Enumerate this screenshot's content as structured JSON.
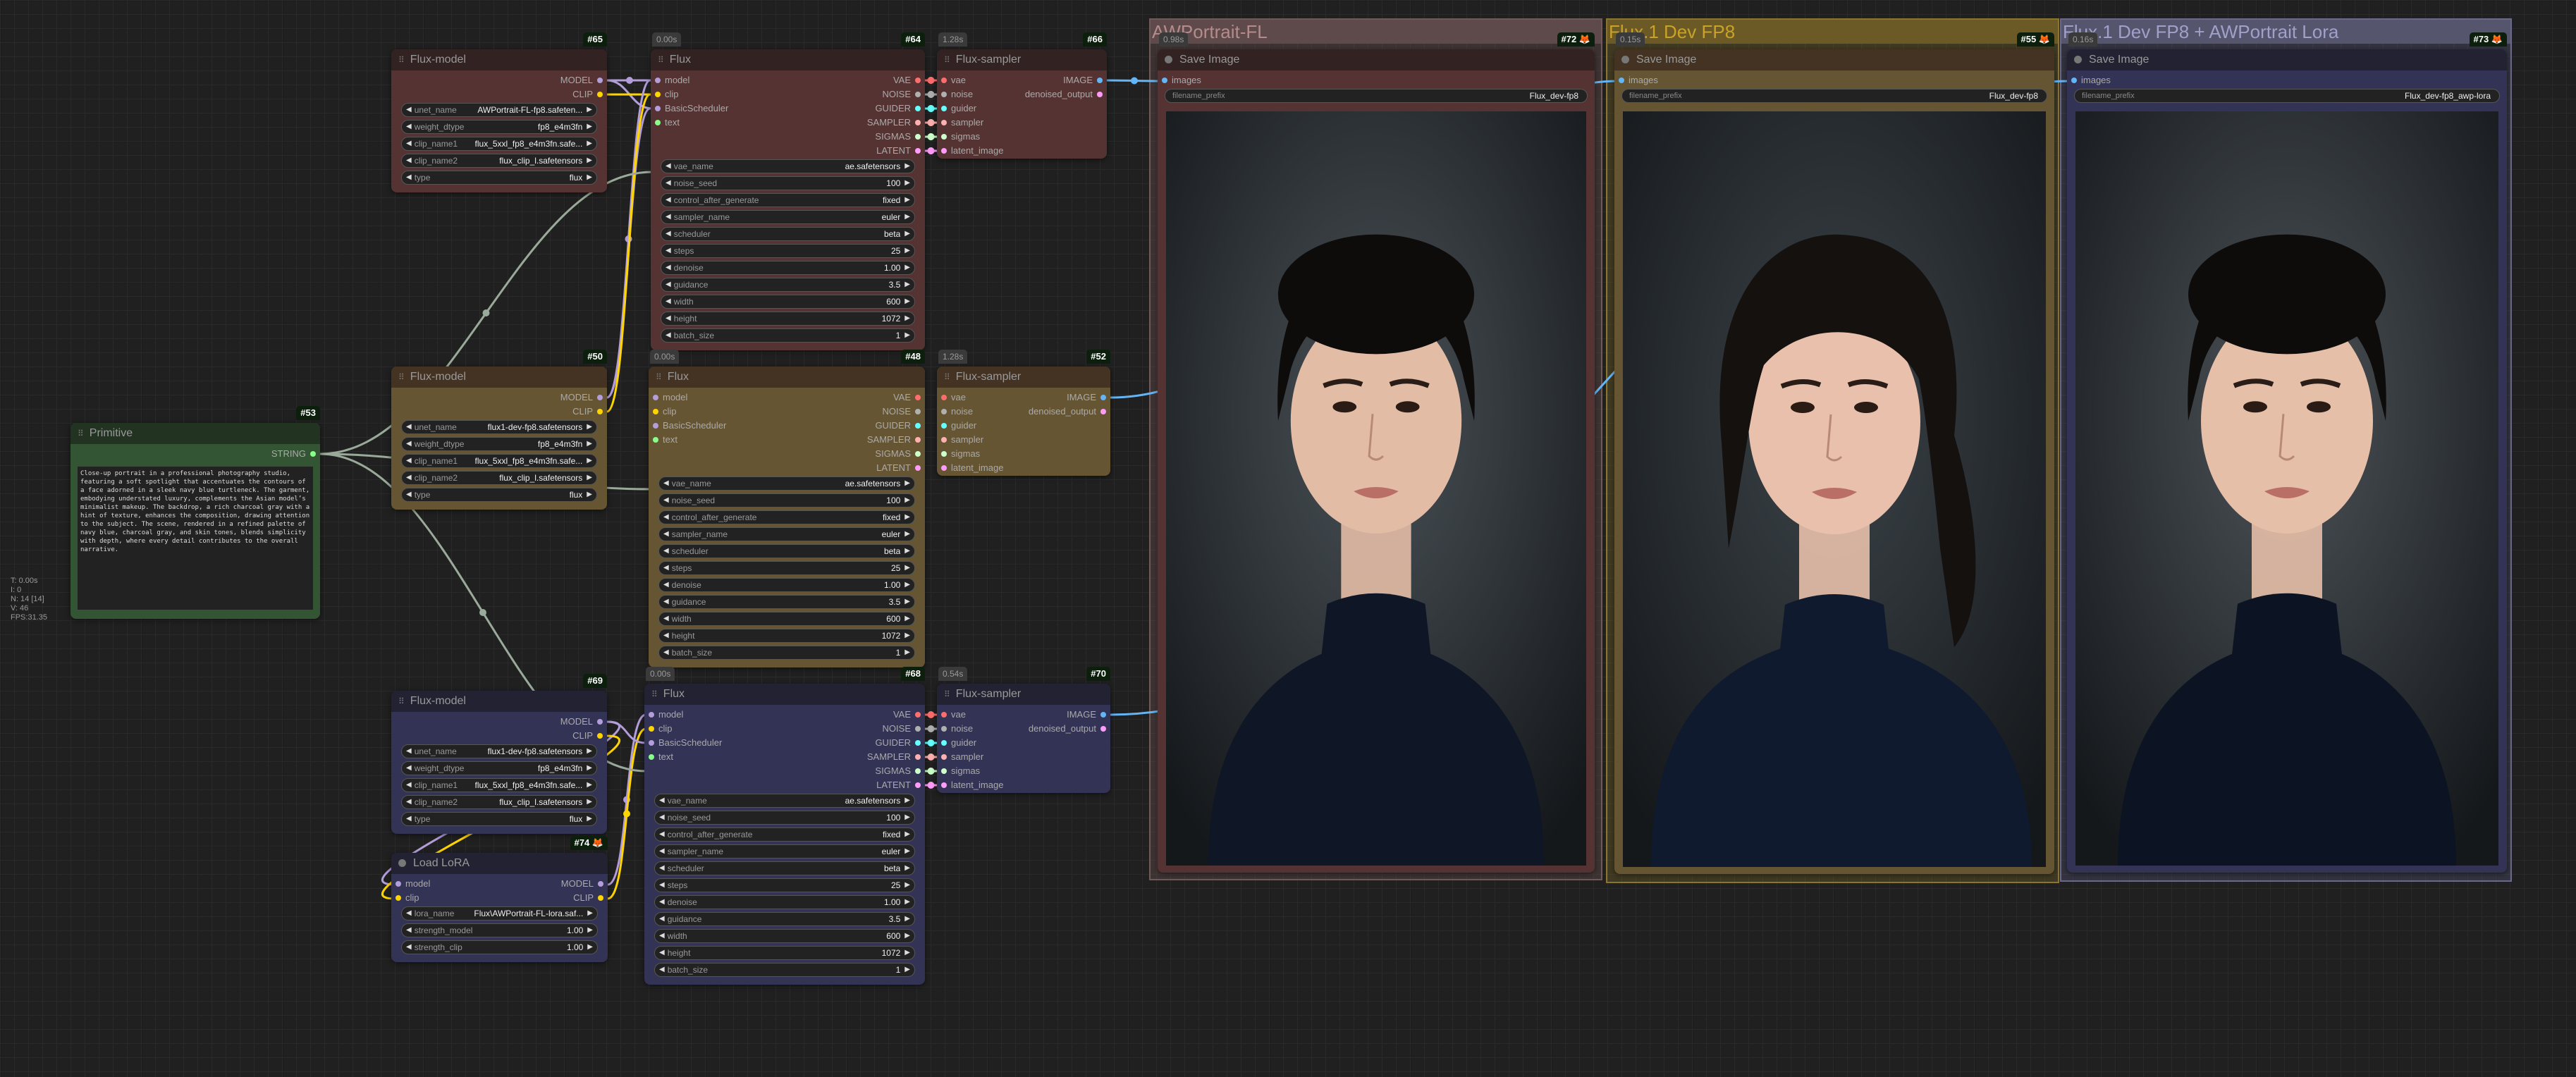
{
  "stats": [
    "T: 0.00s",
    "I: 0",
    "N: 14 [14]",
    "V: 46",
    "FPS:31.35"
  ],
  "slot_colors": {
    "MODEL": "#b39ddb",
    "CLIP": "#ffd500",
    "SCHED": "#b39ddb",
    "STRING": "#88ff88",
    "VAE": "#ff6e6e",
    "NOISE": "#b0b0b0",
    "GUIDER": "#66ffff",
    "SAMPLER": "#ffb0b0",
    "SIGMAS": "#cdffcd",
    "LATENT": "#ff9cf9",
    "IMAGE": "#64b5f6"
  },
  "groups": [
    {
      "key": "g1",
      "title": "AWPortrait-FL",
      "header": "#5e4a4a",
      "body": "rgba(120,90,90,0.35)",
      "border": "#6e5a5a",
      "color": "#b58b8b"
    },
    {
      "key": "g2",
      "title": "Flux.1 Dev FP8",
      "header": "#6b5a26",
      "body": "rgba(130,110,40,0.35)",
      "border": "#8a7530",
      "color": "#c9a227"
    },
    {
      "key": "g3",
      "title": "Flux.1 Dev FP8 + AWPortrait Lora",
      "header": "#55556e",
      "body": "rgba(90,90,130,0.35)",
      "border": "#6a6a88",
      "color": "#a0a0c8"
    }
  ],
  "nodes": [
    {
      "key": "n53",
      "id": "#53",
      "title": "Primitive",
      "theme": "green",
      "kind": "primitive",
      "outputs": [
        {
          "name": "STRING",
          "type": "STRING"
        }
      ],
      "text": "Close-up portrait in a professional photography studio, featuring a soft spotlight that accentuates the contours of a face adorned in a sleek navy blue turtleneck. The garment, embodying understated luxury, complements the Asian model’s minimalist makeup. The backdrop, a rich charcoal gray with a hint of texture, enhances the composition, drawing attention to the subject. The scene, rendered in a refined palette of navy blue, charcoal gray, and skin tones, blends simplicity with depth, where every detail contributes to the overall narrative."
    },
    {
      "key": "n65",
      "id": "#65",
      "title": "Flux-model",
      "theme": "red",
      "inputs": [],
      "outputs": [
        {
          "name": "MODEL",
          "type": "MODEL"
        },
        {
          "name": "CLIP",
          "type": "CLIP"
        }
      ],
      "widgets": [
        {
          "label": "unet_name",
          "value": "AWPortrait-FL-fp8.safeten..."
        },
        {
          "label": "weight_dtype",
          "value": "fp8_e4m3fn"
        },
        {
          "label": "clip_name1",
          "value": "flux_5xxl_fp8_e4m3fn.safe..."
        },
        {
          "label": "clip_name2",
          "value": "flux_clip_l.safetensors"
        },
        {
          "label": "type",
          "value": "flux"
        }
      ]
    },
    {
      "key": "n64",
      "id": "#64",
      "time": "0.00s",
      "title": "Flux",
      "theme": "red",
      "inputs": [
        {
          "name": "model",
          "type": "MODEL"
        },
        {
          "name": "clip",
          "type": "CLIP"
        },
        {
          "name": "BasicScheduler",
          "type": "SCHED"
        },
        {
          "name": "text",
          "type": "STRING"
        }
      ],
      "outputs": [
        {
          "name": "VAE",
          "type": "VAE"
        },
        {
          "name": "NOISE",
          "type": "NOISE"
        },
        {
          "name": "GUIDER",
          "type": "GUIDER"
        },
        {
          "name": "SAMPLER",
          "type": "SAMPLER"
        },
        {
          "name": "SIGMAS",
          "type": "SIGMAS"
        },
        {
          "name": "LATENT",
          "type": "LATENT"
        }
      ],
      "widgets": [
        {
          "label": "vae_name",
          "value": "ae.safetensors"
        },
        {
          "label": "noise_seed",
          "value": "100"
        },
        {
          "label": "control_after_generate",
          "value": "fixed"
        },
        {
          "label": "sampler_name",
          "value": "euler"
        },
        {
          "label": "scheduler",
          "value": "beta"
        },
        {
          "label": "steps",
          "value": "25"
        },
        {
          "label": "denoise",
          "value": "1.00"
        },
        {
          "label": "guidance",
          "value": "3.5"
        },
        {
          "label": "width",
          "value": "600"
        },
        {
          "label": "height",
          "value": "1072"
        },
        {
          "label": "batch_size",
          "value": "1"
        }
      ]
    },
    {
      "key": "n66",
      "id": "#66",
      "time": "1.28s",
      "title": "Flux-sampler",
      "theme": "red",
      "inputs": [
        {
          "name": "vae",
          "type": "VAE"
        },
        {
          "name": "noise",
          "type": "NOISE"
        },
        {
          "name": "guider",
          "type": "GUIDER"
        },
        {
          "name": "sampler",
          "type": "SAMPLER"
        },
        {
          "name": "sigmas",
          "type": "SIGMAS"
        },
        {
          "name": "latent_image",
          "type": "LATENT"
        }
      ],
      "outputs": [
        {
          "name": "IMAGE",
          "type": "IMAGE"
        },
        {
          "name": "denoised_output",
          "type": "LATENT"
        }
      ],
      "widgets": []
    },
    {
      "key": "n50",
      "id": "#50",
      "title": "Flux-model",
      "theme": "brown",
      "inputs": [],
      "outputs": [
        {
          "name": "MODEL",
          "type": "MODEL"
        },
        {
          "name": "CLIP",
          "type": "CLIP"
        }
      ],
      "widgets": [
        {
          "label": "unet_name",
          "value": "flux1-dev-fp8.safetensors"
        },
        {
          "label": "weight_dtype",
          "value": "fp8_e4m3fn"
        },
        {
          "label": "clip_name1",
          "value": "flux_5xxl_fp8_e4m3fn.safe..."
        },
        {
          "label": "clip_name2",
          "value": "flux_clip_l.safetensors"
        },
        {
          "label": "type",
          "value": "flux"
        }
      ]
    },
    {
      "key": "n48",
      "id": "#48",
      "time": "0.00s",
      "title": "Flux",
      "theme": "brown",
      "inputs": [
        {
          "name": "model",
          "type": "MODEL"
        },
        {
          "name": "clip",
          "type": "CLIP"
        },
        {
          "name": "BasicScheduler",
          "type": "SCHED"
        },
        {
          "name": "text",
          "type": "STRING"
        }
      ],
      "outputs": [
        {
          "name": "VAE",
          "type": "VAE"
        },
        {
          "name": "NOISE",
          "type": "NOISE"
        },
        {
          "name": "GUIDER",
          "type": "GUIDER"
        },
        {
          "name": "SAMPLER",
          "type": "SAMPLER"
        },
        {
          "name": "SIGMAS",
          "type": "SIGMAS"
        },
        {
          "name": "LATENT",
          "type": "LATENT"
        }
      ],
      "widgets": [
        {
          "label": "vae_name",
          "value": "ae.safetensors"
        },
        {
          "label": "noise_seed",
          "value": "100"
        },
        {
          "label": "control_after_generate",
          "value": "fixed"
        },
        {
          "label": "sampler_name",
          "value": "euler"
        },
        {
          "label": "scheduler",
          "value": "beta"
        },
        {
          "label": "steps",
          "value": "25"
        },
        {
          "label": "denoise",
          "value": "1.00"
        },
        {
          "label": "guidance",
          "value": "3.5"
        },
        {
          "label": "width",
          "value": "600"
        },
        {
          "label": "height",
          "value": "1072"
        },
        {
          "label": "batch_size",
          "value": "1"
        }
      ]
    },
    {
      "key": "n52",
      "id": "#52",
      "time": "1.28s",
      "title": "Flux-sampler",
      "theme": "brown",
      "inputs": [
        {
          "name": "vae",
          "type": "VAE"
        },
        {
          "name": "noise",
          "type": "NOISE"
        },
        {
          "name": "guider",
          "type": "GUIDER"
        },
        {
          "name": "sampler",
          "type": "SAMPLER"
        },
        {
          "name": "sigmas",
          "type": "SIGMAS"
        },
        {
          "name": "latent_image",
          "type": "LATENT"
        }
      ],
      "outputs": [
        {
          "name": "IMAGE",
          "type": "IMAGE"
        },
        {
          "name": "denoised_output",
          "type": "LATENT"
        }
      ],
      "widgets": []
    },
    {
      "key": "n69",
      "id": "#69",
      "title": "Flux-model",
      "theme": "blue",
      "inputs": [],
      "outputs": [
        {
          "name": "MODEL",
          "type": "MODEL"
        },
        {
          "name": "CLIP",
          "type": "CLIP"
        }
      ],
      "widgets": [
        {
          "label": "unet_name",
          "value": "flux1-dev-fp8.safetensors"
        },
        {
          "label": "weight_dtype",
          "value": "fp8_e4m3fn"
        },
        {
          "label": "clip_name1",
          "value": "flux_5xxl_fp8_e4m3fn.safe..."
        },
        {
          "label": "clip_name2",
          "value": "flux_clip_l.safetensors"
        },
        {
          "label": "type",
          "value": "flux"
        }
      ]
    },
    {
      "key": "n68",
      "id": "#68",
      "time": "0.00s",
      "title": "Flux",
      "theme": "blue",
      "inputs": [
        {
          "name": "model",
          "type": "MODEL"
        },
        {
          "name": "clip",
          "type": "CLIP"
        },
        {
          "name": "BasicScheduler",
          "type": "SCHED"
        },
        {
          "name": "text",
          "type": "STRING"
        }
      ],
      "outputs": [
        {
          "name": "VAE",
          "type": "VAE"
        },
        {
          "name": "NOISE",
          "type": "NOISE"
        },
        {
          "name": "GUIDER",
          "type": "GUIDER"
        },
        {
          "name": "SAMPLER",
          "type": "SAMPLER"
        },
        {
          "name": "SIGMAS",
          "type": "SIGMAS"
        },
        {
          "name": "LATENT",
          "type": "LATENT"
        }
      ],
      "widgets": [
        {
          "label": "vae_name",
          "value": "ae.safetensors"
        },
        {
          "label": "noise_seed",
          "value": "100"
        },
        {
          "label": "control_after_generate",
          "value": "fixed"
        },
        {
          "label": "sampler_name",
          "value": "euler"
        },
        {
          "label": "scheduler",
          "value": "beta"
        },
        {
          "label": "steps",
          "value": "25"
        },
        {
          "label": "denoise",
          "value": "1.00"
        },
        {
          "label": "guidance",
          "value": "3.5"
        },
        {
          "label": "width",
          "value": "600"
        },
        {
          "label": "height",
          "value": "1072"
        },
        {
          "label": "batch_size",
          "value": "1"
        }
      ]
    },
    {
      "key": "n70",
      "id": "#70",
      "time": "0.54s",
      "title": "Flux-sampler",
      "theme": "blue",
      "inputs": [
        {
          "name": "vae",
          "type": "VAE"
        },
        {
          "name": "noise",
          "type": "NOISE"
        },
        {
          "name": "guider",
          "type": "GUIDER"
        },
        {
          "name": "sampler",
          "type": "SAMPLER"
        },
        {
          "name": "sigmas",
          "type": "SIGMAS"
        },
        {
          "name": "latent_image",
          "type": "LATENT"
        }
      ],
      "outputs": [
        {
          "name": "IMAGE",
          "type": "IMAGE"
        },
        {
          "name": "denoised_output",
          "type": "LATENT"
        }
      ],
      "widgets": []
    },
    {
      "key": "n74",
      "id": "#74 🦊",
      "title": "Load LoRA",
      "theme": "blue",
      "dot": true,
      "inputs": [
        {
          "name": "model",
          "type": "MODEL"
        },
        {
          "name": "clip",
          "type": "CLIP"
        }
      ],
      "outputs": [
        {
          "name": "MODEL",
          "type": "MODEL"
        },
        {
          "name": "CLIP",
          "type": "CLIP"
        }
      ],
      "widgets": [
        {
          "label": "lora_name",
          "value": "Flux\\AWPortrait-FL-lora.saf..."
        },
        {
          "label": "strength_model",
          "value": "1.00"
        },
        {
          "label": "strength_clip",
          "value": "1.00"
        }
      ]
    },
    {
      "key": "n72",
      "id": "#72 🦊",
      "time": "0.98s",
      "title": "Save Image",
      "theme": "red",
      "kind": "save",
      "dot": true,
      "inputs": [
        {
          "name": "images",
          "type": "IMAGE"
        }
      ],
      "outputs": [],
      "widgets": [
        {
          "label": "filename_prefix",
          "value": "Flux_dev-fp8"
        }
      ],
      "variant": 0
    },
    {
      "key": "n55",
      "id": "#55 🦊",
      "time": "0.15s",
      "title": "Save Image",
      "theme": "brown",
      "kind": "save",
      "dot": true,
      "inputs": [
        {
          "name": "images",
          "type": "IMAGE"
        }
      ],
      "outputs": [],
      "widgets": [
        {
          "label": "filename_prefix",
          "value": "Flux_dev-fp8"
        }
      ],
      "variant": 1
    },
    {
      "key": "n73",
      "id": "#73 🦊",
      "time": "0.16s",
      "title": "Save Image",
      "theme": "blue",
      "kind": "save",
      "dot": true,
      "inputs": [
        {
          "name": "images",
          "type": "IMAGE"
        }
      ],
      "outputs": [],
      "widgets": [
        {
          "label": "filename_prefix",
          "value": "Flux_dev-fp8_awp-lora"
        }
      ],
      "variant": 2
    }
  ]
}
